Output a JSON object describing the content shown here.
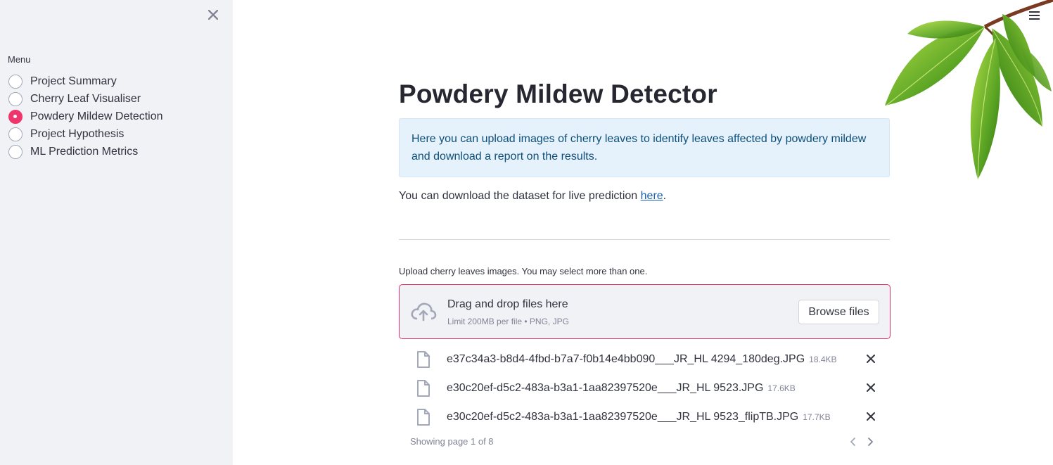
{
  "sidebar": {
    "close_icon": "close-icon",
    "menu_label": "Menu",
    "items": [
      {
        "label": "Project Summary",
        "selected": false
      },
      {
        "label": "Cherry Leaf Visualiser",
        "selected": false
      },
      {
        "label": "Powdery Mildew Detection",
        "selected": true
      },
      {
        "label": "Project Hypothesis",
        "selected": false
      },
      {
        "label": "ML Prediction Metrics",
        "selected": false
      }
    ],
    "accent_color": "#f0356c"
  },
  "header": {
    "menu_icon": "hamburger-icon"
  },
  "main": {
    "title": "Powdery Mildew Detector",
    "info_text": "Here you can upload images of cherry leaves to identify leaves affected by powdery mildew and download a report on the results.",
    "dataset_prefix": "You can download the dataset for live prediction ",
    "dataset_link": "here",
    "dataset_suffix": ".",
    "uploader": {
      "label": "Upload cherry leaves images. You may select more than one.",
      "drop_title": "Drag and drop files here",
      "drop_sub": "Limit 200MB per file • PNG, JPG",
      "browse_label": "Browse files",
      "border_color": "#e0306a"
    },
    "files": [
      {
        "name": "e37c34a3-b8d4-4fbd-b7a7-f0b14e4bb090___JR_HL 4294_180deg.JPG",
        "size": "18.4KB"
      },
      {
        "name": "e30c20ef-d5c2-483a-b3a1-1aa82397520e___JR_HL 9523.JPG",
        "size": "17.6KB"
      },
      {
        "name": "e30c20ef-d5c2-483a-b3a1-1aa82397520e___JR_HL 9523_flipTB.JPG",
        "size": "17.7KB"
      }
    ],
    "pager_text": "Showing page 1 of 8"
  }
}
